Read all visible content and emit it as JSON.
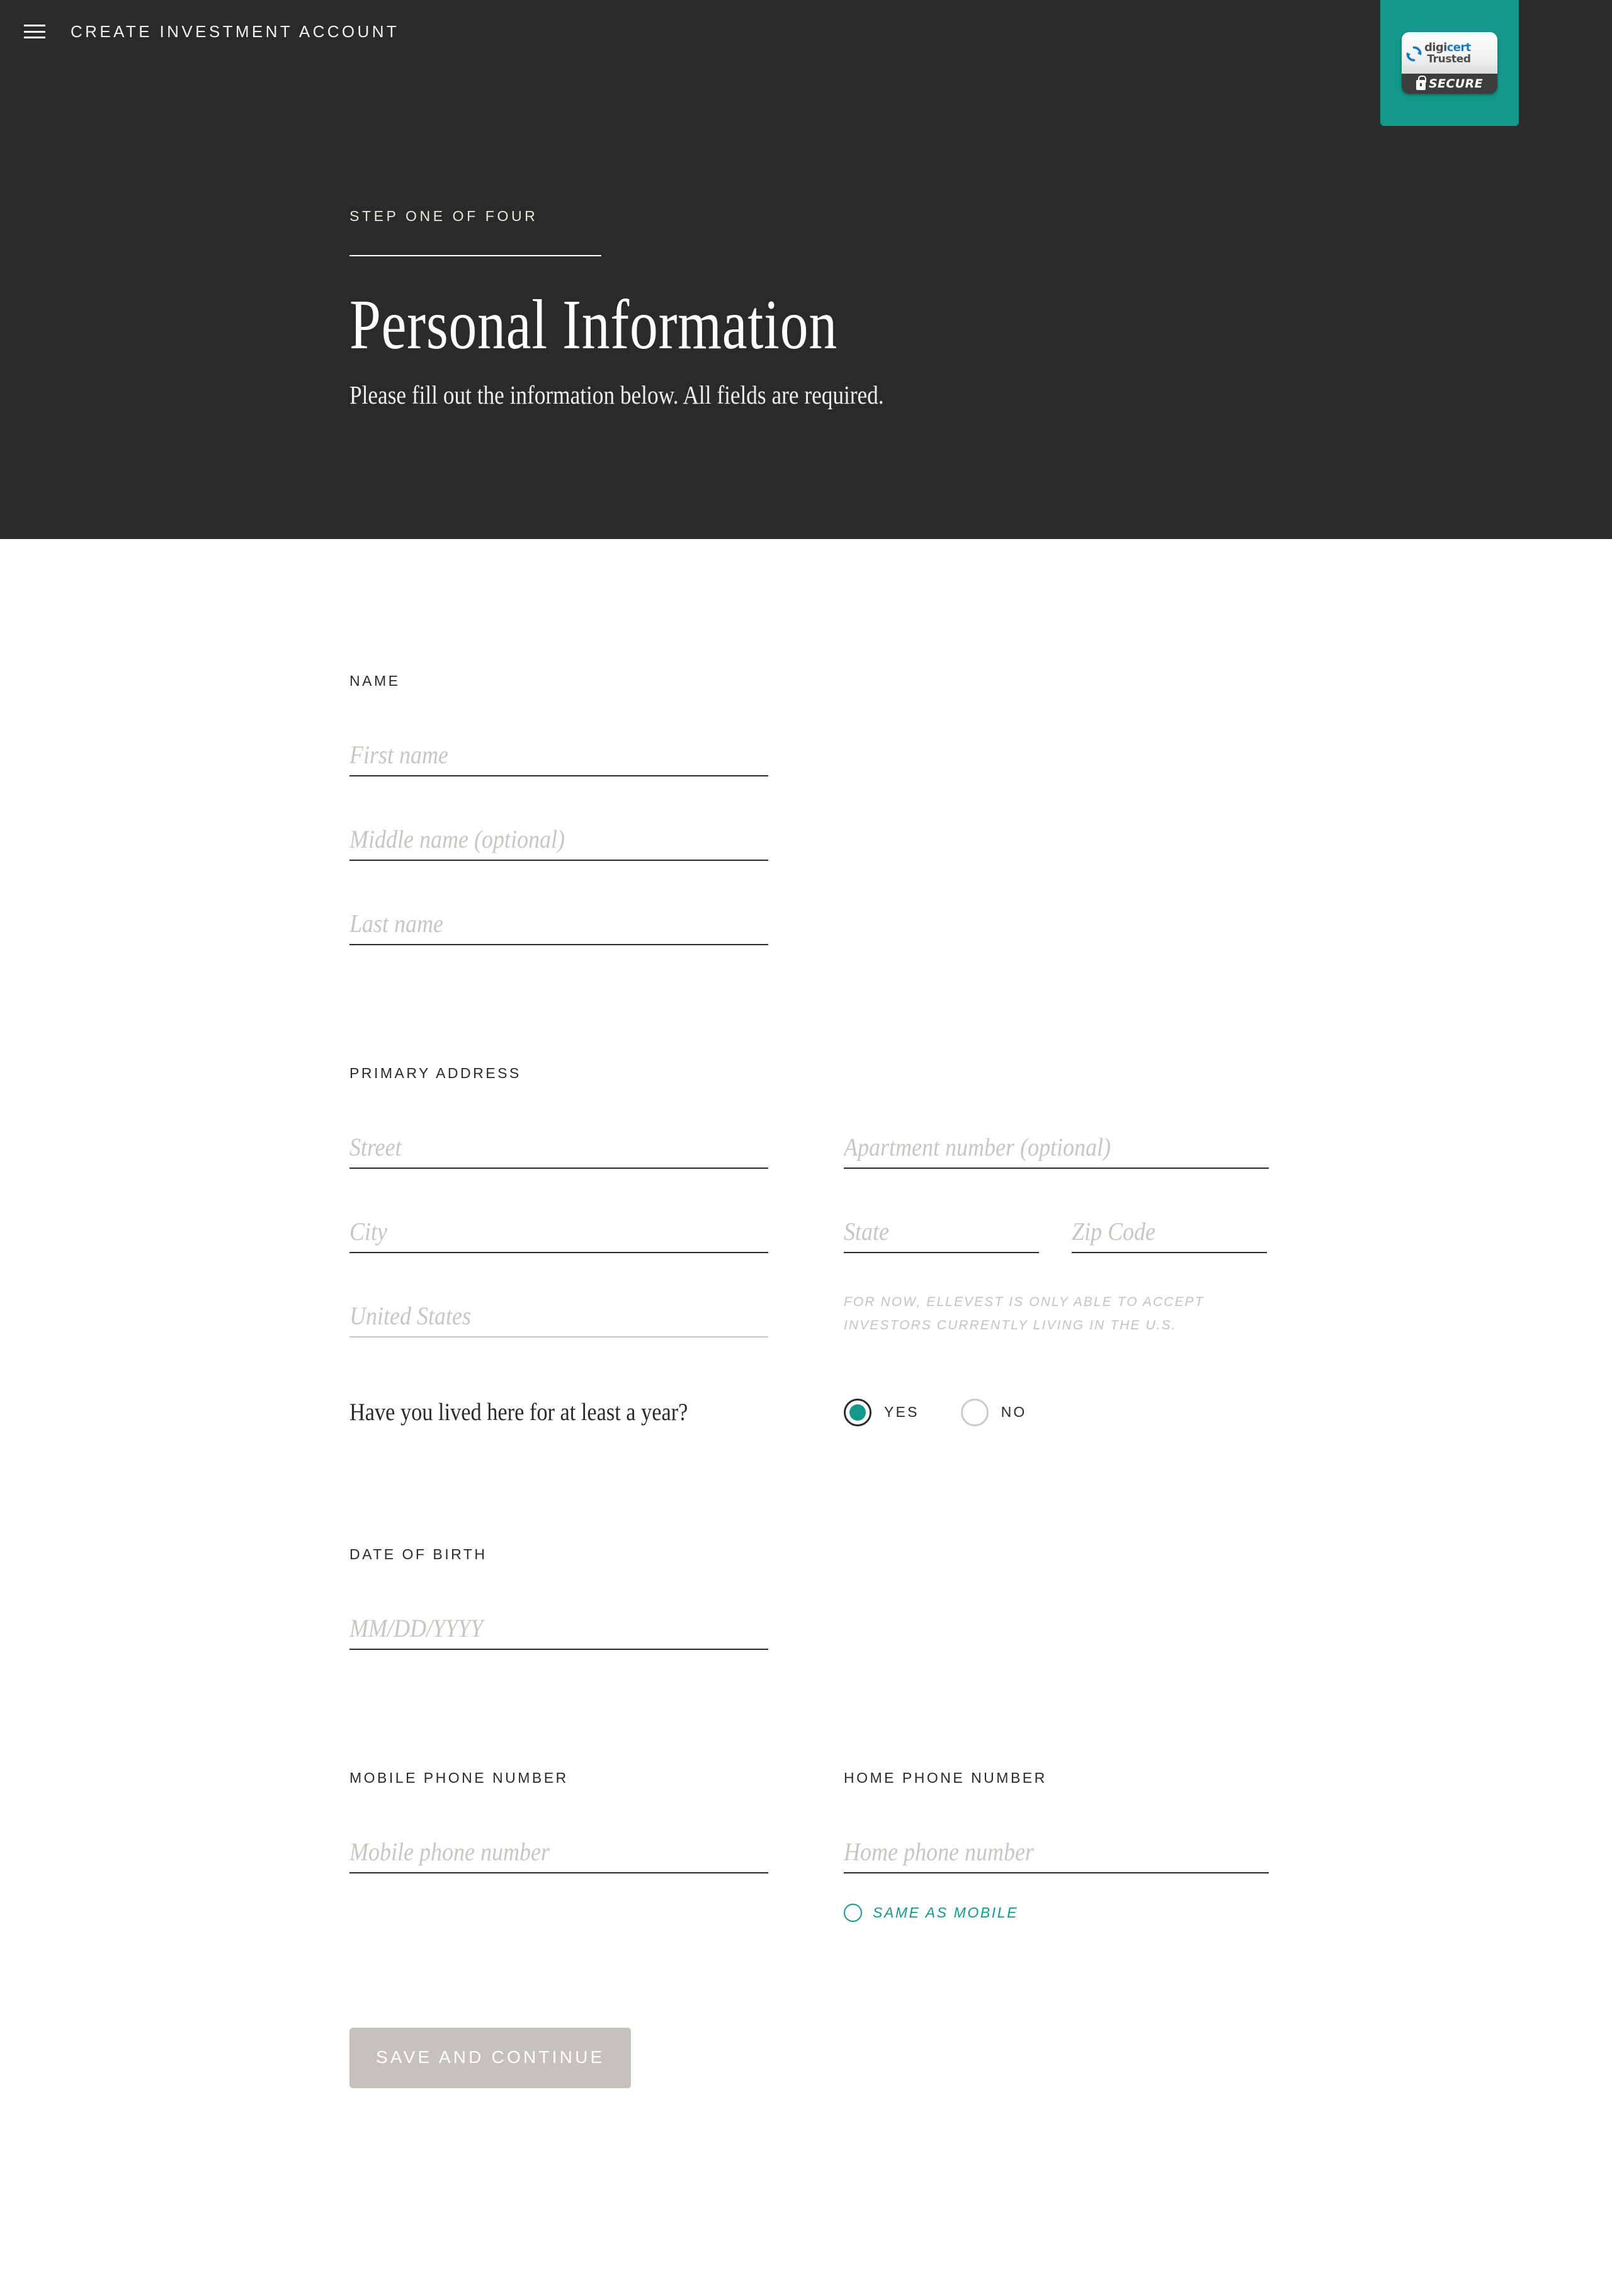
{
  "header": {
    "menu_icon": "hamburger-menu-icon",
    "brand_title": "CREATE INVESTMENT ACCOUNT",
    "step_label": "STEP ONE OF FOUR",
    "page_title": "Personal Information",
    "page_subtitle": "Please fill out the information below. All fields are required."
  },
  "trust_badge": {
    "logo_text_1": "digi",
    "logo_text_2": "cert",
    "trusted_label": "Trusted",
    "secure_label": "SECURE",
    "lock_icon": "lock-icon",
    "background_color": "#12998c"
  },
  "form": {
    "name_section": {
      "label": "NAME",
      "first_name_placeholder": "First name",
      "first_name_value": "",
      "middle_name_placeholder": "Middle name (optional)",
      "middle_name_value": "",
      "last_name_placeholder": "Last name",
      "last_name_value": ""
    },
    "address_section": {
      "label": "PRIMARY ADDRESS",
      "street_placeholder": "Street",
      "street_value": "",
      "apartment_placeholder": "Apartment number (optional)",
      "apartment_value": "",
      "city_placeholder": "City",
      "city_value": "",
      "state_placeholder": "State",
      "state_value": "",
      "zip_placeholder": "Zip Code",
      "zip_value": "",
      "country_placeholder": "United States",
      "country_value": "",
      "country_note": "FOR NOW, ELLEVEST IS ONLY ABLE TO ACCEPT INVESTORS CURRENTLY LIVING IN THE U.S.",
      "residency_question": "Have you lived here for at least a year?",
      "residency_yes": "YES",
      "residency_no": "NO",
      "residency_selected": "YES"
    },
    "dob_section": {
      "label": "DATE OF BIRTH",
      "dob_placeholder": "MM/DD/YYYY",
      "dob_value": ""
    },
    "phone_section": {
      "mobile_label": "MOBILE PHONE NUMBER",
      "mobile_placeholder": "Mobile phone number",
      "mobile_value": "",
      "home_label": "HOME PHONE NUMBER",
      "home_placeholder": "Home phone number",
      "home_value": "",
      "same_as_mobile_label": "SAME AS MOBILE",
      "same_as_mobile_checked": false
    },
    "submit_label": "SAVE AND CONTINUE",
    "submit_enabled": false
  },
  "colors": {
    "header_background": "#2b2a28",
    "accent_teal": "#12998c",
    "underline": "#2b2a28",
    "placeholder": "#c9c5c1",
    "disabled_button": "#c5c2be"
  }
}
